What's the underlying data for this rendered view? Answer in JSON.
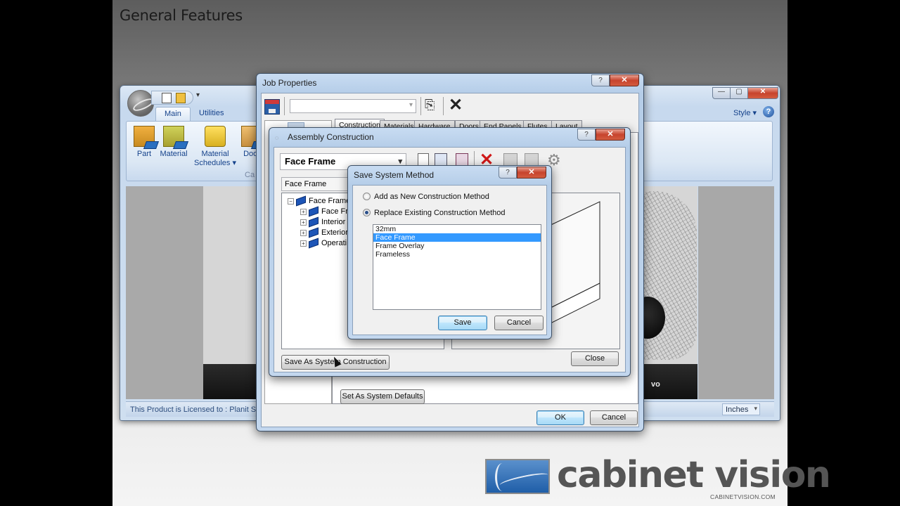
{
  "slide": {
    "title": "General Features"
  },
  "main_window": {
    "quick_access_more": "▾",
    "tabs": [
      {
        "label": "Main",
        "active": true
      },
      {
        "label": "Utilities",
        "active": false
      }
    ],
    "ribbon_buttons": [
      {
        "label": "Part",
        "icon": "part-icon"
      },
      {
        "label": "Material",
        "icon": "material-icon"
      },
      {
        "label": "Material\nSchedules ▾",
        "line1": "Material",
        "line2": "Schedules ▾",
        "icon": "material-schedules-icon"
      },
      {
        "label": "Door",
        "icon": "door-icon"
      }
    ],
    "ribbon_group_label": "Ca",
    "style_menu": "Style  ▾",
    "help_icon": "?",
    "window_controls": {
      "minimize": "—",
      "maximize": "▢",
      "close": "✕"
    },
    "status_text": "This Product is Licensed to : Planit So",
    "units": "Inches",
    "splash_text": "vo"
  },
  "job_properties": {
    "title": "Job Properties",
    "help": "?",
    "close": "✕",
    "combo_value": "",
    "tabs": [
      "Construction",
      "Materials",
      "Hardware",
      "Doors",
      "End Panels",
      "Flutes",
      "Layout"
    ],
    "active_tab": "Construction",
    "set_defaults_label": "Set As System Defaults",
    "ok_label": "OK",
    "cancel_label": "Cancel"
  },
  "assembly_construction": {
    "title": "Assembly Construction",
    "help": "?",
    "close": "✕",
    "method_combo": "Face Frame",
    "filter_combo": "Face Frame",
    "tree": {
      "root": {
        "label": "Face Frame",
        "expander": "−"
      },
      "children": [
        {
          "label": "Face Fr",
          "expander": "+"
        },
        {
          "label": "Interior",
          "expander": "+"
        },
        {
          "label": "Exterior",
          "expander": "+"
        },
        {
          "label": "Operati",
          "expander": "+"
        }
      ]
    },
    "save_as_system_label": "Save As System Construction",
    "close_label": "Close",
    "preview_colors": {
      "frame": "#e8141c"
    }
  },
  "save_system_method": {
    "title": "Save System Method",
    "help": "?",
    "close": "✕",
    "options": [
      {
        "label": "Add as New Construction Method",
        "selected": false
      },
      {
        "label": "Replace Existing Construction Method",
        "selected": true
      }
    ],
    "methods": [
      "32mm",
      "Face Frame",
      "Frame Overlay",
      "Frameless"
    ],
    "selected_method": "Face Frame",
    "save_label": "Save",
    "cancel_label": "Cancel"
  },
  "branding": {
    "logo_text": "cabinet vision",
    "registered": "®",
    "url": "CABINETVISION.COM"
  }
}
